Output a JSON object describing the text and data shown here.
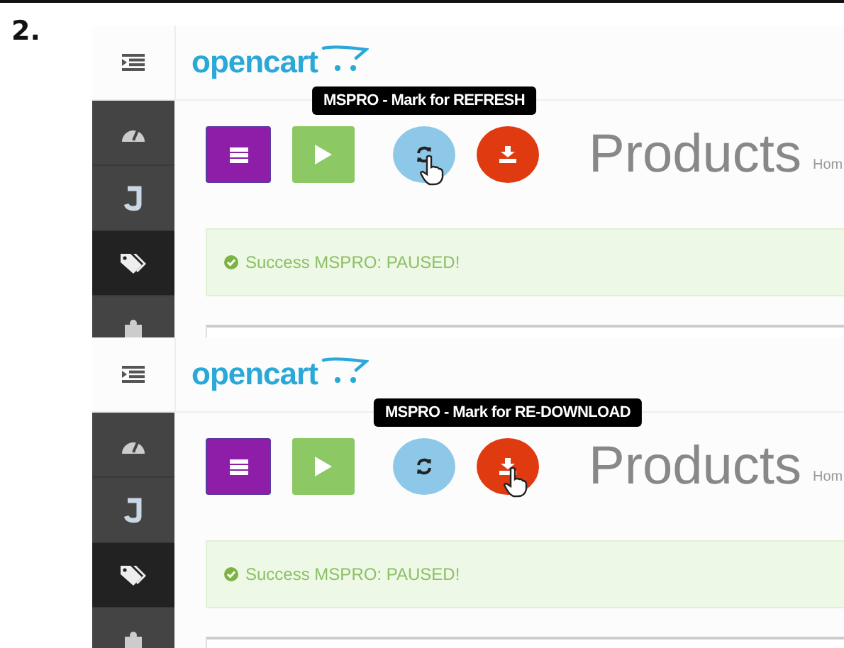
{
  "step_label": "2.",
  "panels": [
    {
      "logo": "opencart",
      "sidebar": [
        {
          "kind": "dashboard",
          "selected": false
        },
        {
          "kind": "joomla",
          "selected": false
        },
        {
          "kind": "tags",
          "selected": true
        },
        {
          "kind": "puzzle",
          "selected": false
        }
      ],
      "buttons": [
        {
          "kind": "list"
        },
        {
          "kind": "play"
        },
        {
          "kind": "refresh",
          "tooltip": "MSPRO - Mark for REFRESH"
        },
        {
          "kind": "download"
        }
      ],
      "heading": "Products",
      "breadcrumb": "Hom",
      "alert": "Success MSPRO: PAUSED!"
    },
    {
      "logo": "opencart",
      "sidebar": [
        {
          "kind": "dashboard",
          "selected": false
        },
        {
          "kind": "joomla",
          "selected": false
        },
        {
          "kind": "tags",
          "selected": true
        },
        {
          "kind": "puzzle",
          "selected": false
        }
      ],
      "buttons": [
        {
          "kind": "list"
        },
        {
          "kind": "play"
        },
        {
          "kind": "refresh"
        },
        {
          "kind": "download",
          "tooltip": "MSPRO - Mark for RE-DOWNLOAD"
        }
      ],
      "heading": "Products",
      "breadcrumb": "Hom",
      "alert": "Success MSPRO: PAUSED!"
    }
  ]
}
